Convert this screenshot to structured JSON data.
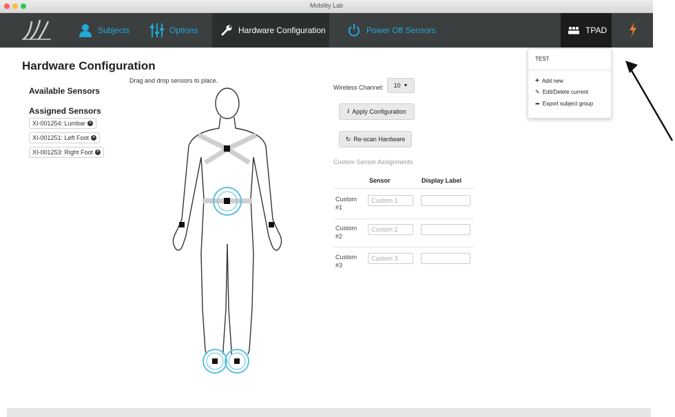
{
  "window": {
    "title": "Mobility Lab"
  },
  "nav": {
    "subjects": "Subjects",
    "options": "Options",
    "hardware": "Hardware Configuration",
    "power": "Power Off Sensors",
    "user": "TPAD"
  },
  "page": {
    "title": "Hardware Configuration",
    "hint": "Drag and drop sensors to place.",
    "available": "Available Sensors",
    "assigned": "Assigned Sensors",
    "assigned_sensors": [
      "XI-001254: Lumbar",
      "XI-001251: Left Foot",
      "XI-001253: Right Foot"
    ]
  },
  "settings": {
    "wireless_label": "Wireless Channel:",
    "wireless_value": "10",
    "apply": "Apply Configuration",
    "rescan": "Re-scan Hardware",
    "custom_title": "Custom Sensor Assignments",
    "col_sensor": "Sensor",
    "col_display": "Display Label",
    "rows": [
      {
        "label": "Custom #1",
        "placeholder": "Custom 1"
      },
      {
        "label": "Custom #2",
        "placeholder": "Custom 2"
      },
      {
        "label": "Custom #3",
        "placeholder": "Custom 3"
      }
    ]
  },
  "dropdown": {
    "subject": "TEST",
    "add": "Add new",
    "edit": "Edit/Delete current",
    "export": "Export subject group"
  },
  "colors": {
    "accent": "#1fa9d6",
    "navbar": "#3b3f40",
    "sensor_ring": "#5bc0de"
  }
}
